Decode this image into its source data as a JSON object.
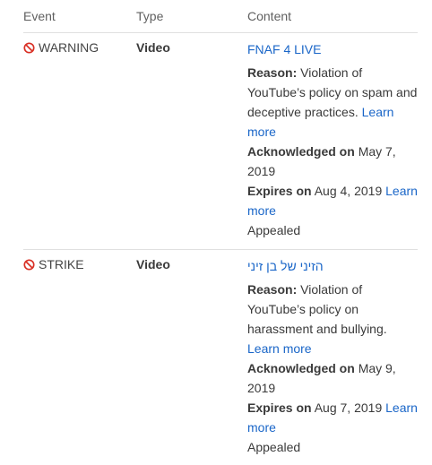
{
  "headers": {
    "event": "Event",
    "type": "Type",
    "content": "Content"
  },
  "rows": [
    {
      "event": "WARNING",
      "type": "Video",
      "video_title": "FNAF 4 LIVE",
      "reason_label": "Reason:",
      "reason_text": "Violation of YouTube’s policy on spam and deceptive practices.",
      "learn_more": "Learn more",
      "acknowledged_label": "Acknowledged on",
      "acknowledged_date": "May 7, 2019",
      "expires_label": "Expires on",
      "expires_date": "Aug 4, 2019",
      "expires_learn_more": "Learn more",
      "status": "Appealed"
    },
    {
      "event": "STRIKE",
      "type": "Video",
      "video_title": "הזיני של בן זיני",
      "reason_label": "Reason:",
      "reason_text": "Violation of YouTube’s policy on harassment and bullying.",
      "learn_more": "Learn more",
      "acknowledged_label": "Acknowledged on",
      "acknowledged_date": "May 9, 2019",
      "expires_label": "Expires on",
      "expires_date": "Aug 7, 2019",
      "expires_learn_more": "Learn more",
      "status": "Appealed"
    }
  ],
  "icons": {
    "event_icon": "ban-icon",
    "event_icon_color": "#d93025"
  },
  "colors": {
    "link": "#1a66c8",
    "divider": "#e0e0e0",
    "header_text": "#606060"
  }
}
